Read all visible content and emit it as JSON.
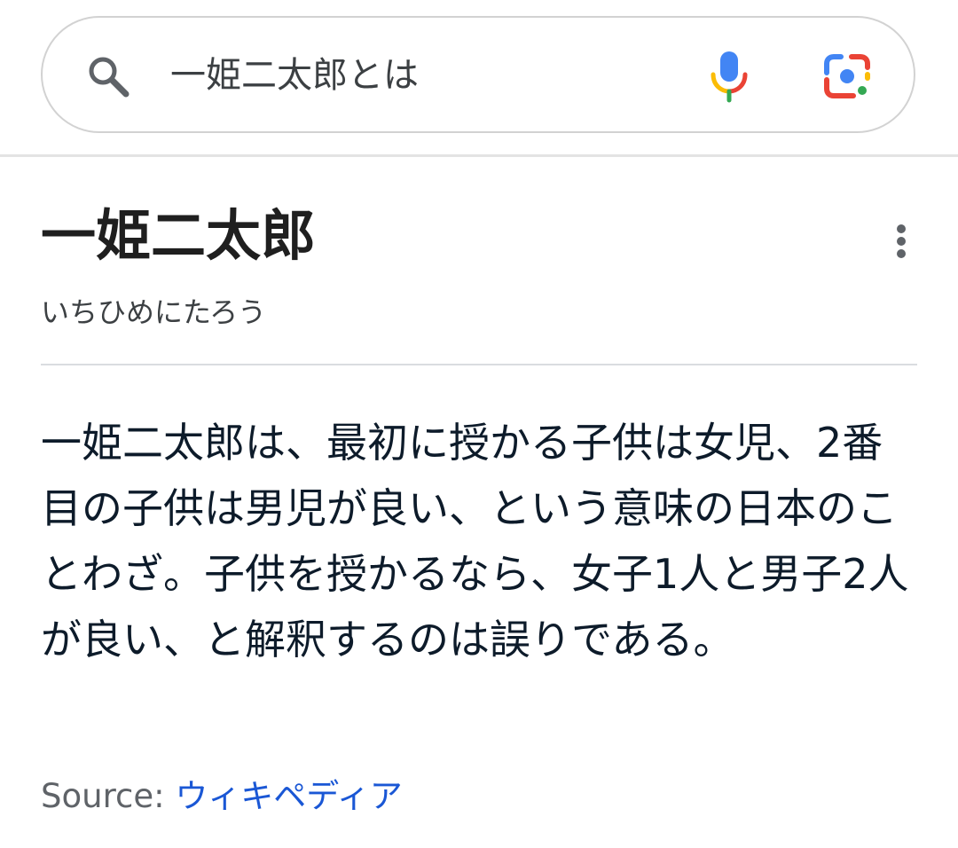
{
  "search": {
    "query": "一姫二太郎とは",
    "icons": {
      "search": "search-icon",
      "voice": "microphone-icon",
      "lens": "camera-lens-icon"
    }
  },
  "knowledge_panel": {
    "title": "一姫二太郎",
    "reading": "いちひめにたろう",
    "description": "一姫二太郎は、最初に授かる子供は女児、2番目の子供は男児が良い、という意味の日本のことわざ。子供を授かるなら、女子1人と男子2人が良い、と解釈するのは誤りである。",
    "source_label": "Source:",
    "source_link": "ウィキペディア",
    "more_icon": "more-vertical-icon"
  },
  "colors": {
    "link": "#1a57d5",
    "text": "#0d1b2a",
    "muted": "#5f6368",
    "google_blue": "#4285F4",
    "google_red": "#EA4335",
    "google_yellow": "#FBBC05",
    "google_green": "#34A853"
  }
}
